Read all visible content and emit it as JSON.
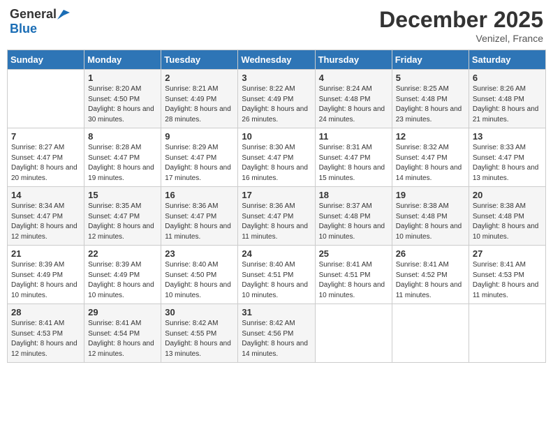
{
  "header": {
    "logo_general": "General",
    "logo_blue": "Blue",
    "month_title": "December 2025",
    "location": "Venizel, France"
  },
  "weekdays": [
    "Sunday",
    "Monday",
    "Tuesday",
    "Wednesday",
    "Thursday",
    "Friday",
    "Saturday"
  ],
  "weeks": [
    [
      {
        "day": "",
        "sunrise": "",
        "sunset": "",
        "daylight": ""
      },
      {
        "day": "1",
        "sunrise": "Sunrise: 8:20 AM",
        "sunset": "Sunset: 4:50 PM",
        "daylight": "Daylight: 8 hours and 30 minutes."
      },
      {
        "day": "2",
        "sunrise": "Sunrise: 8:21 AM",
        "sunset": "Sunset: 4:49 PM",
        "daylight": "Daylight: 8 hours and 28 minutes."
      },
      {
        "day": "3",
        "sunrise": "Sunrise: 8:22 AM",
        "sunset": "Sunset: 4:49 PM",
        "daylight": "Daylight: 8 hours and 26 minutes."
      },
      {
        "day": "4",
        "sunrise": "Sunrise: 8:24 AM",
        "sunset": "Sunset: 4:48 PM",
        "daylight": "Daylight: 8 hours and 24 minutes."
      },
      {
        "day": "5",
        "sunrise": "Sunrise: 8:25 AM",
        "sunset": "Sunset: 4:48 PM",
        "daylight": "Daylight: 8 hours and 23 minutes."
      },
      {
        "day": "6",
        "sunrise": "Sunrise: 8:26 AM",
        "sunset": "Sunset: 4:48 PM",
        "daylight": "Daylight: 8 hours and 21 minutes."
      }
    ],
    [
      {
        "day": "7",
        "sunrise": "Sunrise: 8:27 AM",
        "sunset": "Sunset: 4:47 PM",
        "daylight": "Daylight: 8 hours and 20 minutes."
      },
      {
        "day": "8",
        "sunrise": "Sunrise: 8:28 AM",
        "sunset": "Sunset: 4:47 PM",
        "daylight": "Daylight: 8 hours and 19 minutes."
      },
      {
        "day": "9",
        "sunrise": "Sunrise: 8:29 AM",
        "sunset": "Sunset: 4:47 PM",
        "daylight": "Daylight: 8 hours and 17 minutes."
      },
      {
        "day": "10",
        "sunrise": "Sunrise: 8:30 AM",
        "sunset": "Sunset: 4:47 PM",
        "daylight": "Daylight: 8 hours and 16 minutes."
      },
      {
        "day": "11",
        "sunrise": "Sunrise: 8:31 AM",
        "sunset": "Sunset: 4:47 PM",
        "daylight": "Daylight: 8 hours and 15 minutes."
      },
      {
        "day": "12",
        "sunrise": "Sunrise: 8:32 AM",
        "sunset": "Sunset: 4:47 PM",
        "daylight": "Daylight: 8 hours and 14 minutes."
      },
      {
        "day": "13",
        "sunrise": "Sunrise: 8:33 AM",
        "sunset": "Sunset: 4:47 PM",
        "daylight": "Daylight: 8 hours and 13 minutes."
      }
    ],
    [
      {
        "day": "14",
        "sunrise": "Sunrise: 8:34 AM",
        "sunset": "Sunset: 4:47 PM",
        "daylight": "Daylight: 8 hours and 12 minutes."
      },
      {
        "day": "15",
        "sunrise": "Sunrise: 8:35 AM",
        "sunset": "Sunset: 4:47 PM",
        "daylight": "Daylight: 8 hours and 12 minutes."
      },
      {
        "day": "16",
        "sunrise": "Sunrise: 8:36 AM",
        "sunset": "Sunset: 4:47 PM",
        "daylight": "Daylight: 8 hours and 11 minutes."
      },
      {
        "day": "17",
        "sunrise": "Sunrise: 8:36 AM",
        "sunset": "Sunset: 4:47 PM",
        "daylight": "Daylight: 8 hours and 11 minutes."
      },
      {
        "day": "18",
        "sunrise": "Sunrise: 8:37 AM",
        "sunset": "Sunset: 4:48 PM",
        "daylight": "Daylight: 8 hours and 10 minutes."
      },
      {
        "day": "19",
        "sunrise": "Sunrise: 8:38 AM",
        "sunset": "Sunset: 4:48 PM",
        "daylight": "Daylight: 8 hours and 10 minutes."
      },
      {
        "day": "20",
        "sunrise": "Sunrise: 8:38 AM",
        "sunset": "Sunset: 4:48 PM",
        "daylight": "Daylight: 8 hours and 10 minutes."
      }
    ],
    [
      {
        "day": "21",
        "sunrise": "Sunrise: 8:39 AM",
        "sunset": "Sunset: 4:49 PM",
        "daylight": "Daylight: 8 hours and 10 minutes."
      },
      {
        "day": "22",
        "sunrise": "Sunrise: 8:39 AM",
        "sunset": "Sunset: 4:49 PM",
        "daylight": "Daylight: 8 hours and 10 minutes."
      },
      {
        "day": "23",
        "sunrise": "Sunrise: 8:40 AM",
        "sunset": "Sunset: 4:50 PM",
        "daylight": "Daylight: 8 hours and 10 minutes."
      },
      {
        "day": "24",
        "sunrise": "Sunrise: 8:40 AM",
        "sunset": "Sunset: 4:51 PM",
        "daylight": "Daylight: 8 hours and 10 minutes."
      },
      {
        "day": "25",
        "sunrise": "Sunrise: 8:41 AM",
        "sunset": "Sunset: 4:51 PM",
        "daylight": "Daylight: 8 hours and 10 minutes."
      },
      {
        "day": "26",
        "sunrise": "Sunrise: 8:41 AM",
        "sunset": "Sunset: 4:52 PM",
        "daylight": "Daylight: 8 hours and 11 minutes."
      },
      {
        "day": "27",
        "sunrise": "Sunrise: 8:41 AM",
        "sunset": "Sunset: 4:53 PM",
        "daylight": "Daylight: 8 hours and 11 minutes."
      }
    ],
    [
      {
        "day": "28",
        "sunrise": "Sunrise: 8:41 AM",
        "sunset": "Sunset: 4:53 PM",
        "daylight": "Daylight: 8 hours and 12 minutes."
      },
      {
        "day": "29",
        "sunrise": "Sunrise: 8:41 AM",
        "sunset": "Sunset: 4:54 PM",
        "daylight": "Daylight: 8 hours and 12 minutes."
      },
      {
        "day": "30",
        "sunrise": "Sunrise: 8:42 AM",
        "sunset": "Sunset: 4:55 PM",
        "daylight": "Daylight: 8 hours and 13 minutes."
      },
      {
        "day": "31",
        "sunrise": "Sunrise: 8:42 AM",
        "sunset": "Sunset: 4:56 PM",
        "daylight": "Daylight: 8 hours and 14 minutes."
      },
      {
        "day": "",
        "sunrise": "",
        "sunset": "",
        "daylight": ""
      },
      {
        "day": "",
        "sunrise": "",
        "sunset": "",
        "daylight": ""
      },
      {
        "day": "",
        "sunrise": "",
        "sunset": "",
        "daylight": ""
      }
    ]
  ]
}
